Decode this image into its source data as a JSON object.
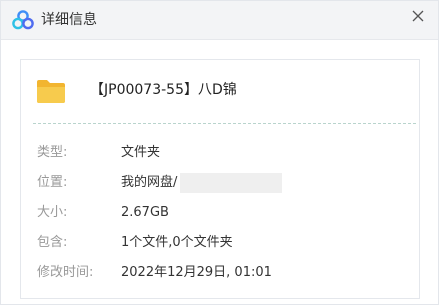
{
  "window": {
    "title": "详细信息",
    "logo_icon": "baidu-netdisk-logo-icon",
    "close_icon": "close-icon"
  },
  "file": {
    "icon": "folder-icon",
    "name": "【JP00073-55】八D锦"
  },
  "details": [
    {
      "label": "类型:",
      "value": "文件夹"
    },
    {
      "label": "位置:",
      "value": "我的网盘/"
    },
    {
      "label": "大小:",
      "value": "2.67GB"
    },
    {
      "label": "包含:",
      "value": "1个文件,0个文件夹"
    },
    {
      "label": "修改时间:",
      "value": "2022年12月29日, 01:01"
    }
  ],
  "colors": {
    "folder": "#f5c242",
    "titlebar_bg": "#f3f4f6",
    "label": "#999999",
    "value": "#333333",
    "logo_blue": "#3f8ef7"
  }
}
